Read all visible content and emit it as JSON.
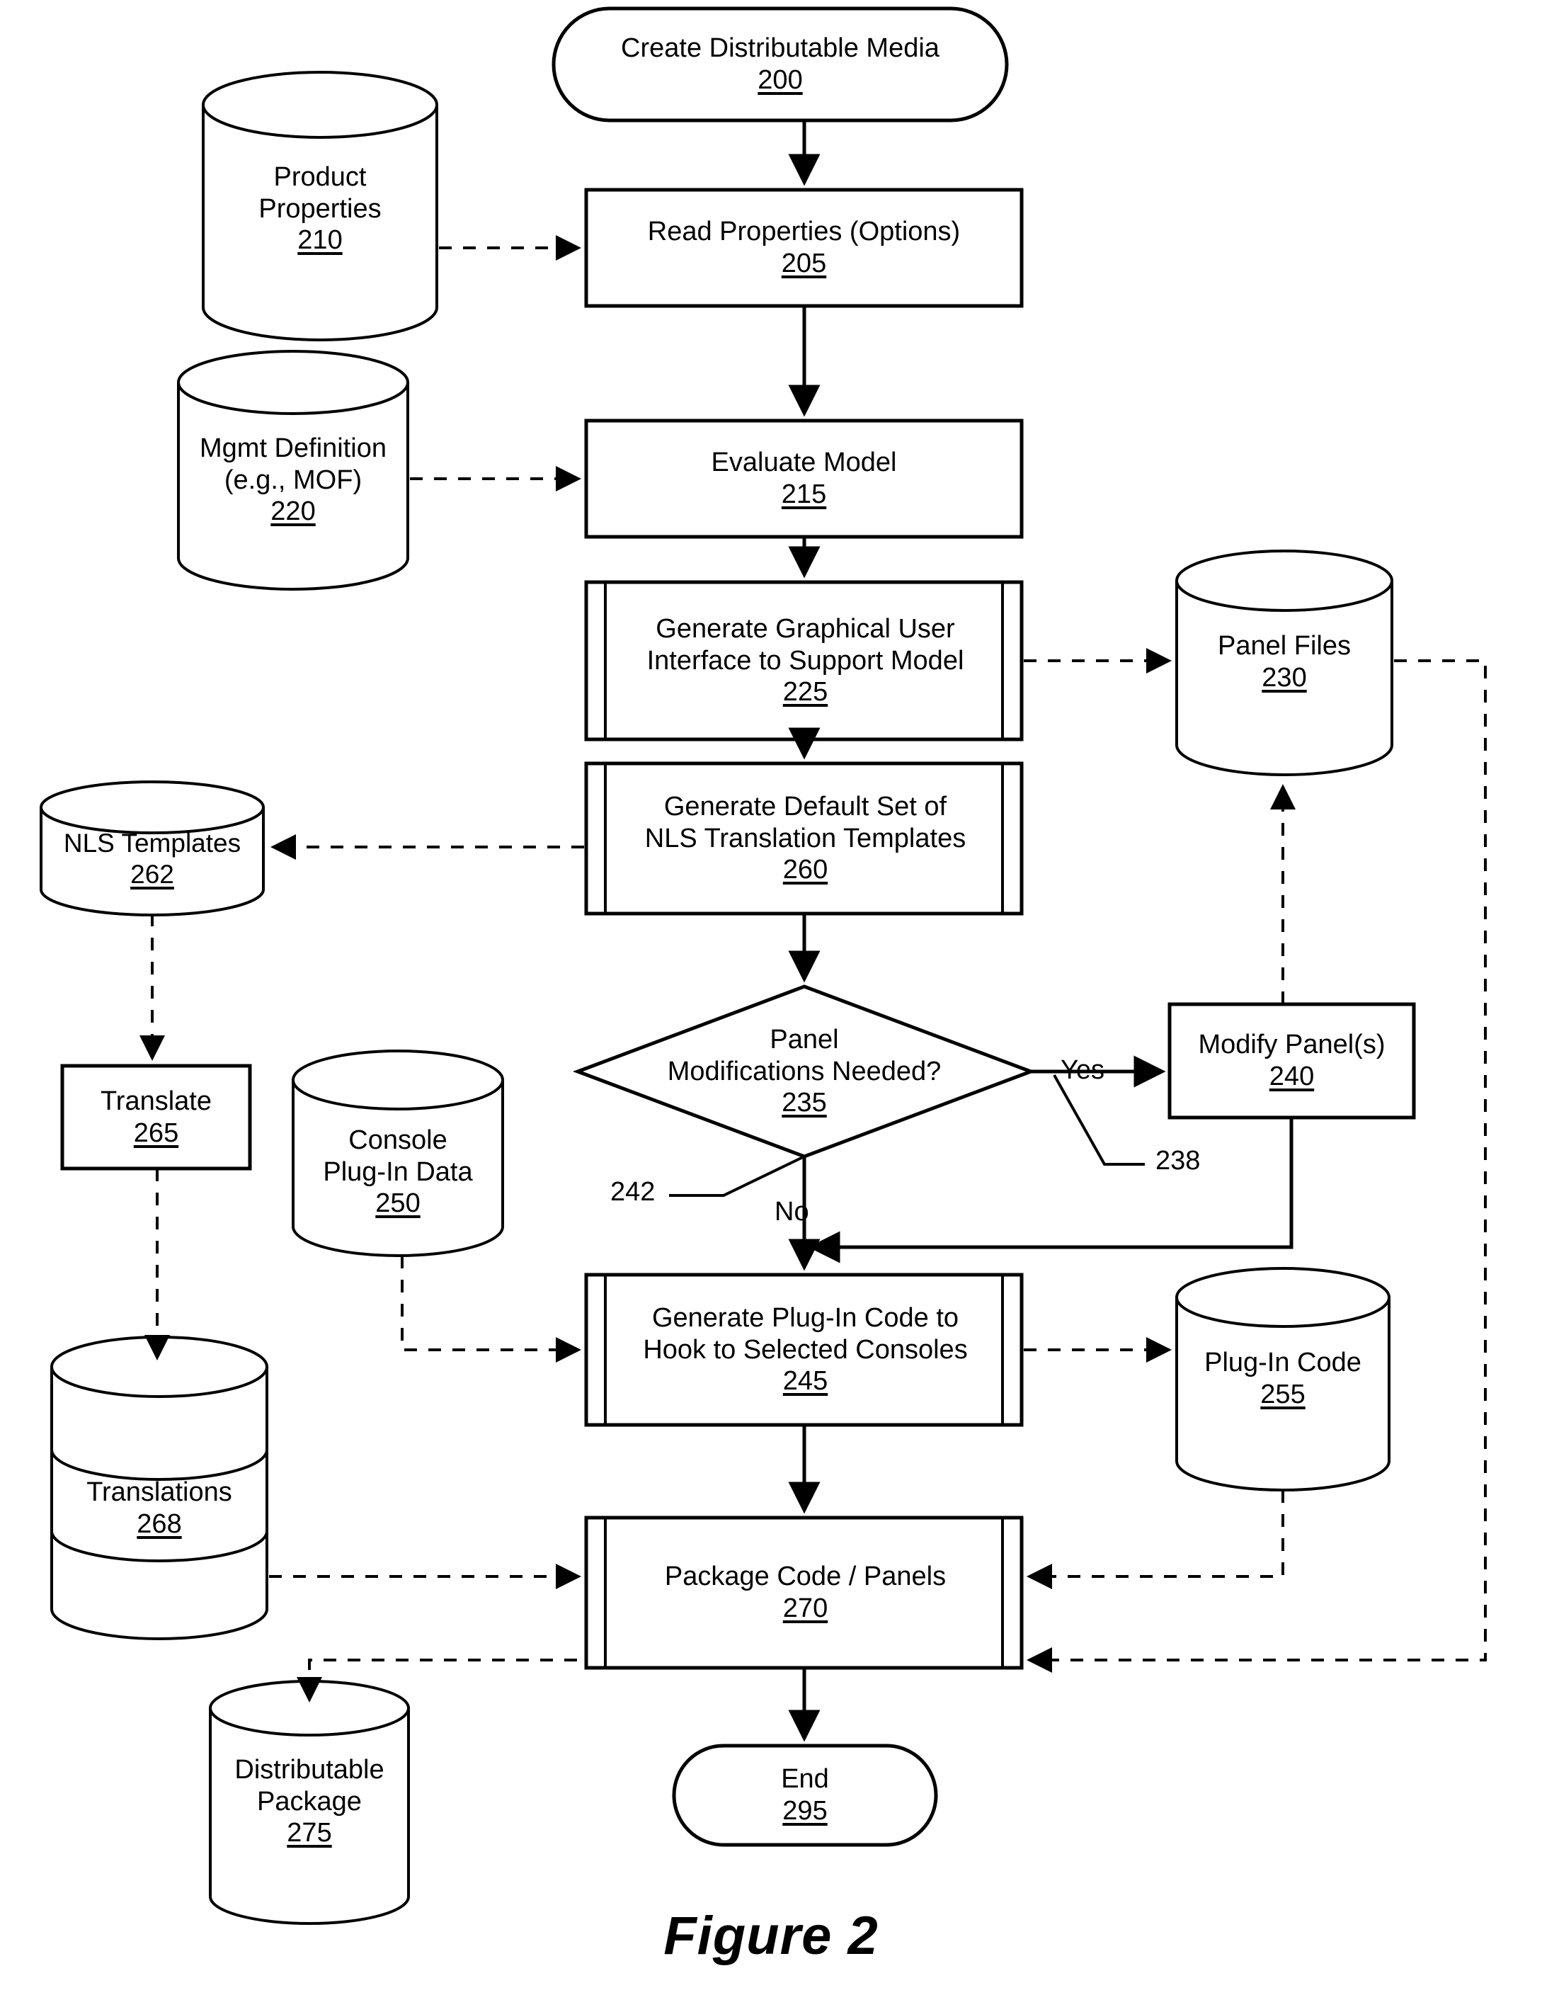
{
  "figure": {
    "caption": "Figure 2",
    "title": "Create Distributable Media process flow"
  },
  "nodes": {
    "start": {
      "shape": "terminator",
      "label": "Create Distributable Media",
      "ref": "200"
    },
    "product_properties": {
      "shape": "cylinder",
      "label_line1": "Product",
      "label_line2": "Properties",
      "ref": "210"
    },
    "read_properties": {
      "shape": "process",
      "label": "Read Properties (Options)",
      "ref": "205"
    },
    "mgmt_definition": {
      "shape": "cylinder",
      "label_line1": "Mgmt Definition",
      "label_line2": "(e.g., MOF)",
      "ref": "220"
    },
    "evaluate_model": {
      "shape": "process",
      "label": "Evaluate Model",
      "ref": "215"
    },
    "generate_gui": {
      "shape": "predefined-process",
      "label_line1": "Generate Graphical User",
      "label_line2": "Interface to Support Model",
      "ref": "225"
    },
    "panel_files": {
      "shape": "cylinder",
      "label": "Panel Files",
      "ref": "230"
    },
    "nls_templates": {
      "shape": "cylinder",
      "label": "NLS Templates",
      "ref": "262"
    },
    "generate_nls": {
      "shape": "predefined-process",
      "label_line1": "Generate Default Set of",
      "label_line2": "NLS Translation Templates",
      "ref": "260"
    },
    "panel_decision": {
      "shape": "decision",
      "label_line1": "Panel",
      "label_line2": "Modifications Needed?",
      "ref": "235"
    },
    "modify_panels": {
      "shape": "process",
      "label": "Modify Panel(s)",
      "ref": "240"
    },
    "translate": {
      "shape": "process",
      "label": "Translate",
      "ref": "265"
    },
    "console_plugin_data": {
      "shape": "cylinder",
      "label_line1": "Console",
      "label_line2": "Plug-In Data",
      "ref": "250"
    },
    "translations": {
      "shape": "stacked-cylinder",
      "label": "Translations",
      "ref": "268"
    },
    "generate_plugin_code": {
      "shape": "predefined-process",
      "label_line1": "Generate Plug-In Code to",
      "label_line2": "Hook to Selected Consoles",
      "ref": "245"
    },
    "plugin_code": {
      "shape": "cylinder",
      "label": "Plug-In Code",
      "ref": "255"
    },
    "package": {
      "shape": "predefined-process",
      "label": "Package Code / Panels",
      "ref": "270"
    },
    "distributable_package": {
      "shape": "cylinder",
      "label_line1": "Distributable",
      "label_line2": "Package",
      "ref": "275"
    },
    "end": {
      "shape": "terminator",
      "label": "End",
      "ref": "295"
    }
  },
  "edge_labels": {
    "yes": "Yes",
    "no": "No"
  },
  "callouts": {
    "yes_branch_ref": "238",
    "no_branch_ref": "242"
  },
  "colors": {
    "stroke": "#000000",
    "fill": "#ffffff",
    "text": "#000000"
  }
}
